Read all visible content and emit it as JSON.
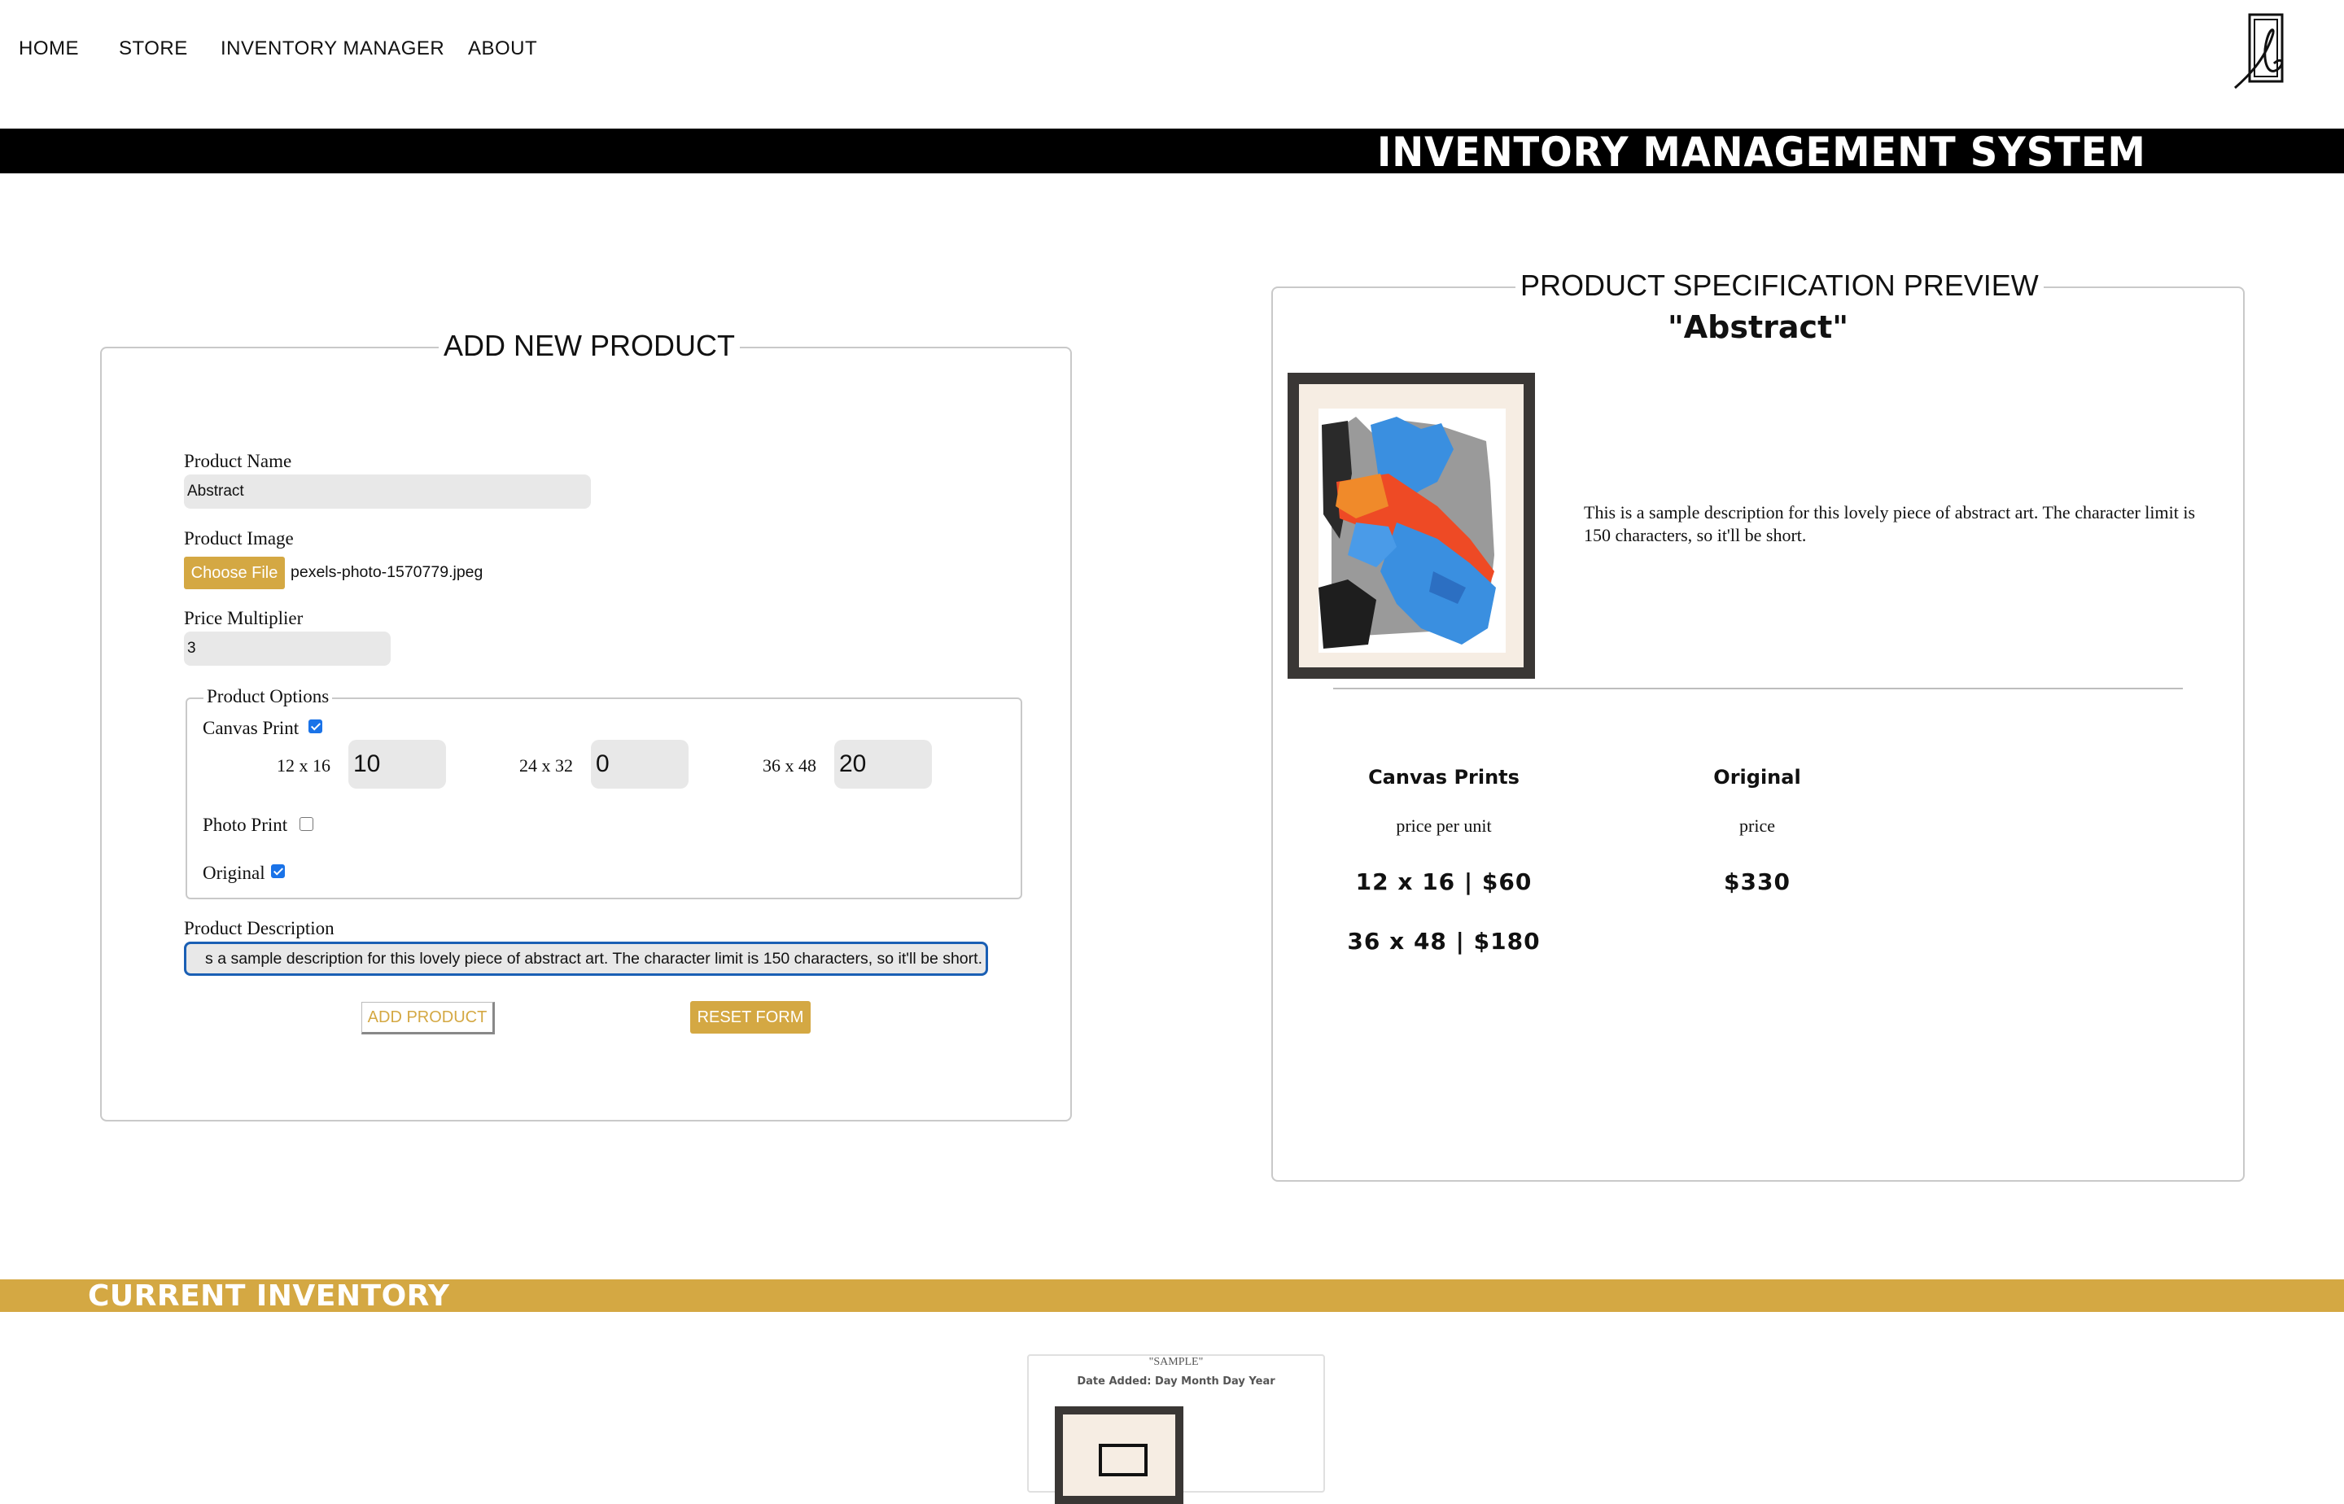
{
  "nav": {
    "items": [
      "HOME",
      "STORE",
      "INVENTORY MANAGER",
      "ABOUT"
    ]
  },
  "banner": {
    "title": "INVENTORY MANAGEMENT SYSTEM"
  },
  "add_form": {
    "legend": "ADD NEW PRODUCT",
    "product_name_label": "Product Name",
    "product_name_value": "Abstract",
    "product_image_label": "Product Image",
    "choose_file_label": "Choose File",
    "file_name": "pexels-photo-1570779.jpeg",
    "price_multiplier_label": "Price Multiplier",
    "price_multiplier_value": "3",
    "options_legend": "Product Options",
    "canvas_print_label": "Canvas Print",
    "canvas_print_checked": true,
    "sizes": [
      {
        "label": "12 x 16",
        "value": "10"
      },
      {
        "label": "24 x 32",
        "value": "0"
      },
      {
        "label": "36 x 48",
        "value": "20"
      }
    ],
    "photo_print_label": "Photo Print",
    "photo_print_checked": false,
    "original_label": "Original",
    "original_checked": true,
    "description_label": "Product Description",
    "description_value": "s a sample description for this lovely piece of abstract art.  The character limit is 150 characters, so it'll be short.",
    "add_button": "ADD PRODUCT",
    "reset_button": "RESET FORM"
  },
  "preview": {
    "legend": "PRODUCT SPECIFICATION PREVIEW",
    "name": "\"Abstract\"",
    "description": "This is a sample description for this lovely piece of abstract art. The character limit is 150 characters, so it'll be short.",
    "canvas_heading": "Canvas Prints",
    "canvas_sub": "price per unit",
    "canvas_prices": [
      "12 x 16 | $60",
      "36 x 48 | $180"
    ],
    "original_heading": "Original",
    "original_sub": "price",
    "original_price": "$330"
  },
  "inventory": {
    "title": "CURRENT INVENTORY",
    "sample_name": "\"SAMPLE\"",
    "sample_date": "Date Added: Day Month Day Year"
  },
  "colors": {
    "accent_gold": "#d4a843",
    "banner_black": "#000000",
    "focus_blue": "#1a5fb4",
    "checkbox_blue": "#1a73e8"
  }
}
